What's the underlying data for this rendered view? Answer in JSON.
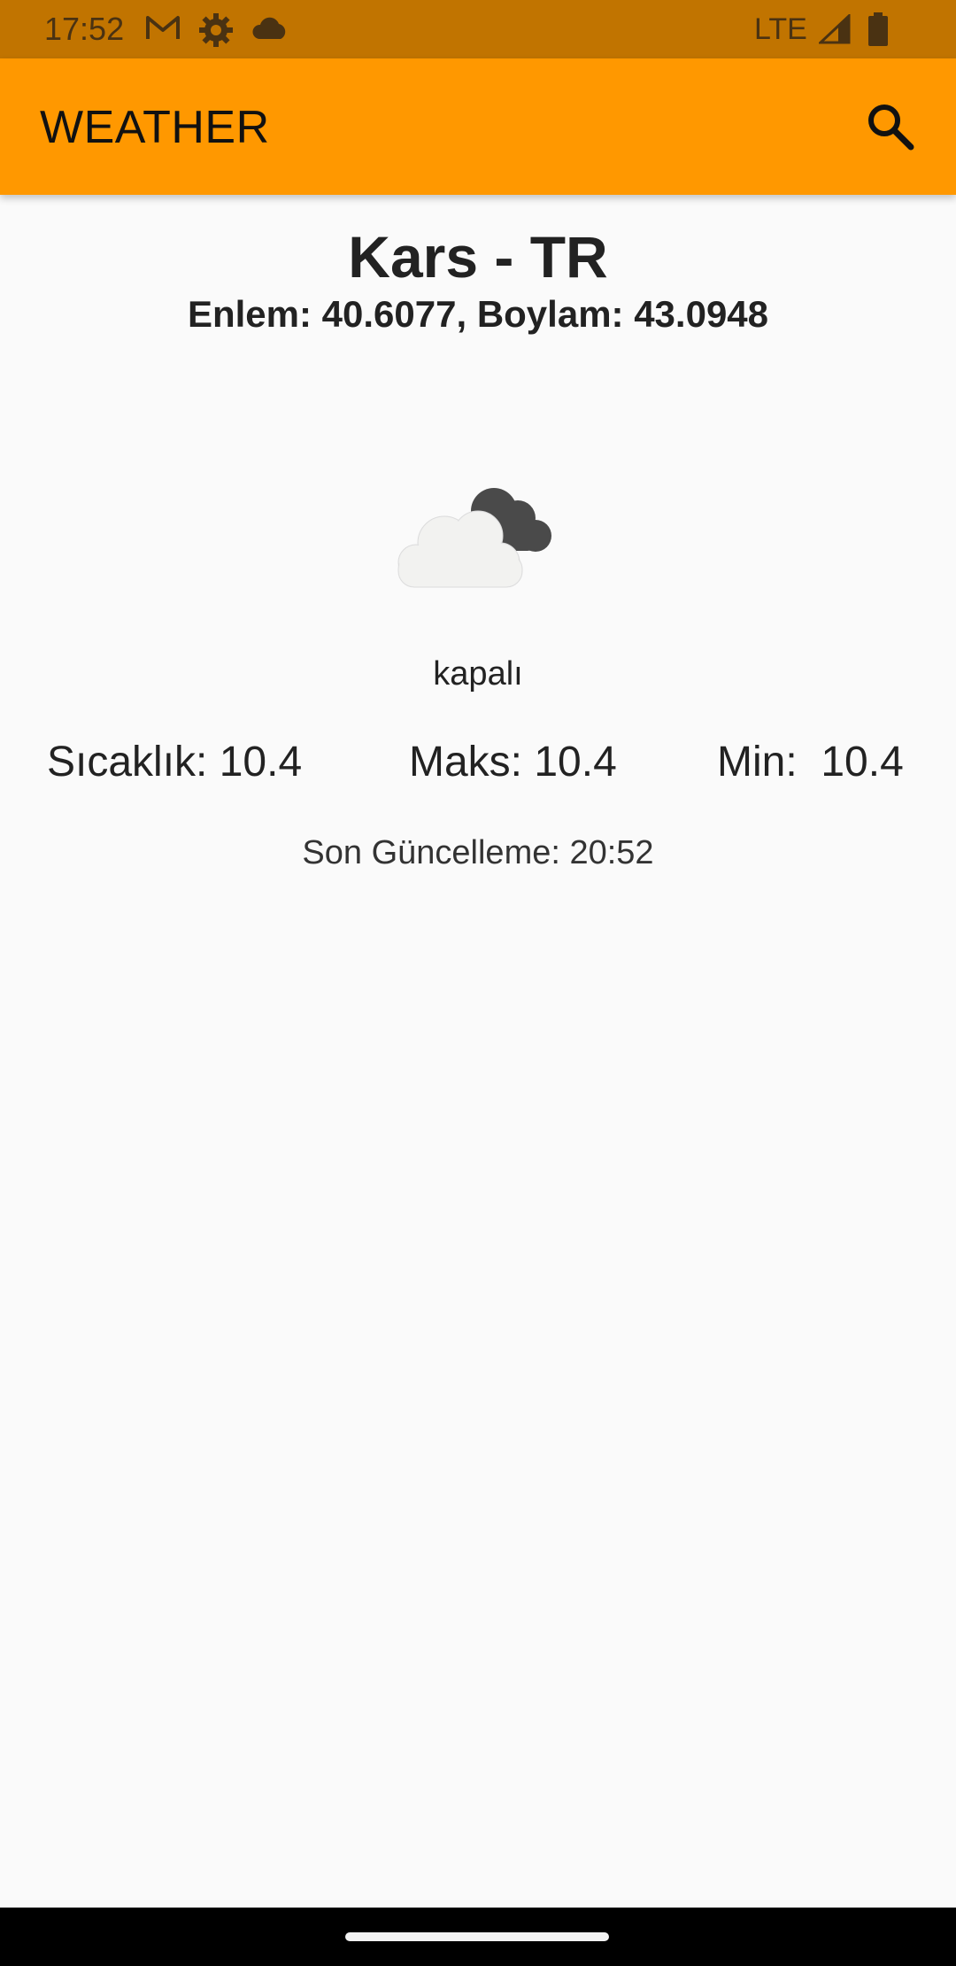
{
  "status_bar": {
    "time": "17:52",
    "network": "LTE",
    "icons": [
      "gmail-icon",
      "settings-gear-icon",
      "cloud-icon",
      "signal-icon",
      "battery-icon"
    ]
  },
  "app_bar": {
    "title": "WEATHER",
    "search_icon": "search-icon",
    "color": "#ff9800"
  },
  "location": {
    "city": "Kars - TR",
    "coordinates": "Enlem: 40.6077, Boylam: 43.0948"
  },
  "weather": {
    "icon": "overcast-cloud-icon",
    "condition": "kapalı",
    "temperature": "Sıcaklık: 10.4",
    "max": "Maks: 10.4",
    "min": "Min:  10.4",
    "last_updated": "Son Güncelleme: 20:52"
  }
}
